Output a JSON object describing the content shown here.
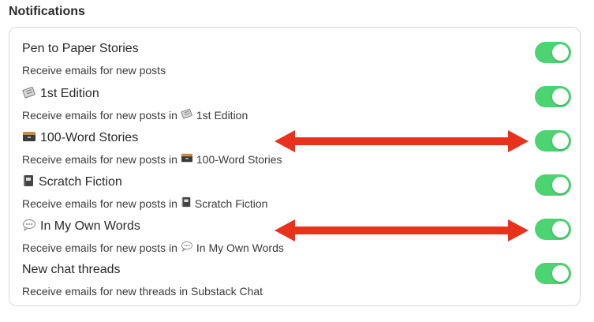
{
  "section_title": "Notifications",
  "colors": {
    "toggle_on": "#4cd372",
    "arrow": "#e8321e"
  },
  "rows": [
    {
      "title": "Pen to Paper Stories",
      "title_icon": "",
      "desc_prefix": "Receive emails for new posts",
      "desc_icon": "",
      "desc_suffix": "",
      "toggle_on": true
    },
    {
      "title": "1st Edition",
      "title_icon": "newspaper-icon",
      "desc_prefix": "Receive emails for new posts in",
      "desc_icon": "newspaper-icon",
      "desc_suffix": "1st Edition",
      "toggle_on": true
    },
    {
      "title": "100-Word Stories",
      "title_icon": "file-box-icon",
      "desc_prefix": "Receive emails for new posts in",
      "desc_icon": "file-box-icon",
      "desc_suffix": "100-Word Stories",
      "toggle_on": true
    },
    {
      "title": "Scratch Fiction",
      "title_icon": "notebook-icon",
      "desc_prefix": "Receive emails for new posts in",
      "desc_icon": "notebook-icon",
      "desc_suffix": "Scratch Fiction",
      "toggle_on": true
    },
    {
      "title": "In My Own Words",
      "title_icon": "speech-bubble-icon",
      "desc_prefix": "Receive emails for new posts in",
      "desc_icon": "speech-bubble-icon",
      "desc_suffix": "In My Own Words",
      "toggle_on": true
    },
    {
      "title": "New chat threads",
      "title_icon": "",
      "desc_prefix": "Receive emails for new threads in Substack Chat",
      "desc_icon": "",
      "desc_suffix": "",
      "toggle_on": true
    }
  ]
}
